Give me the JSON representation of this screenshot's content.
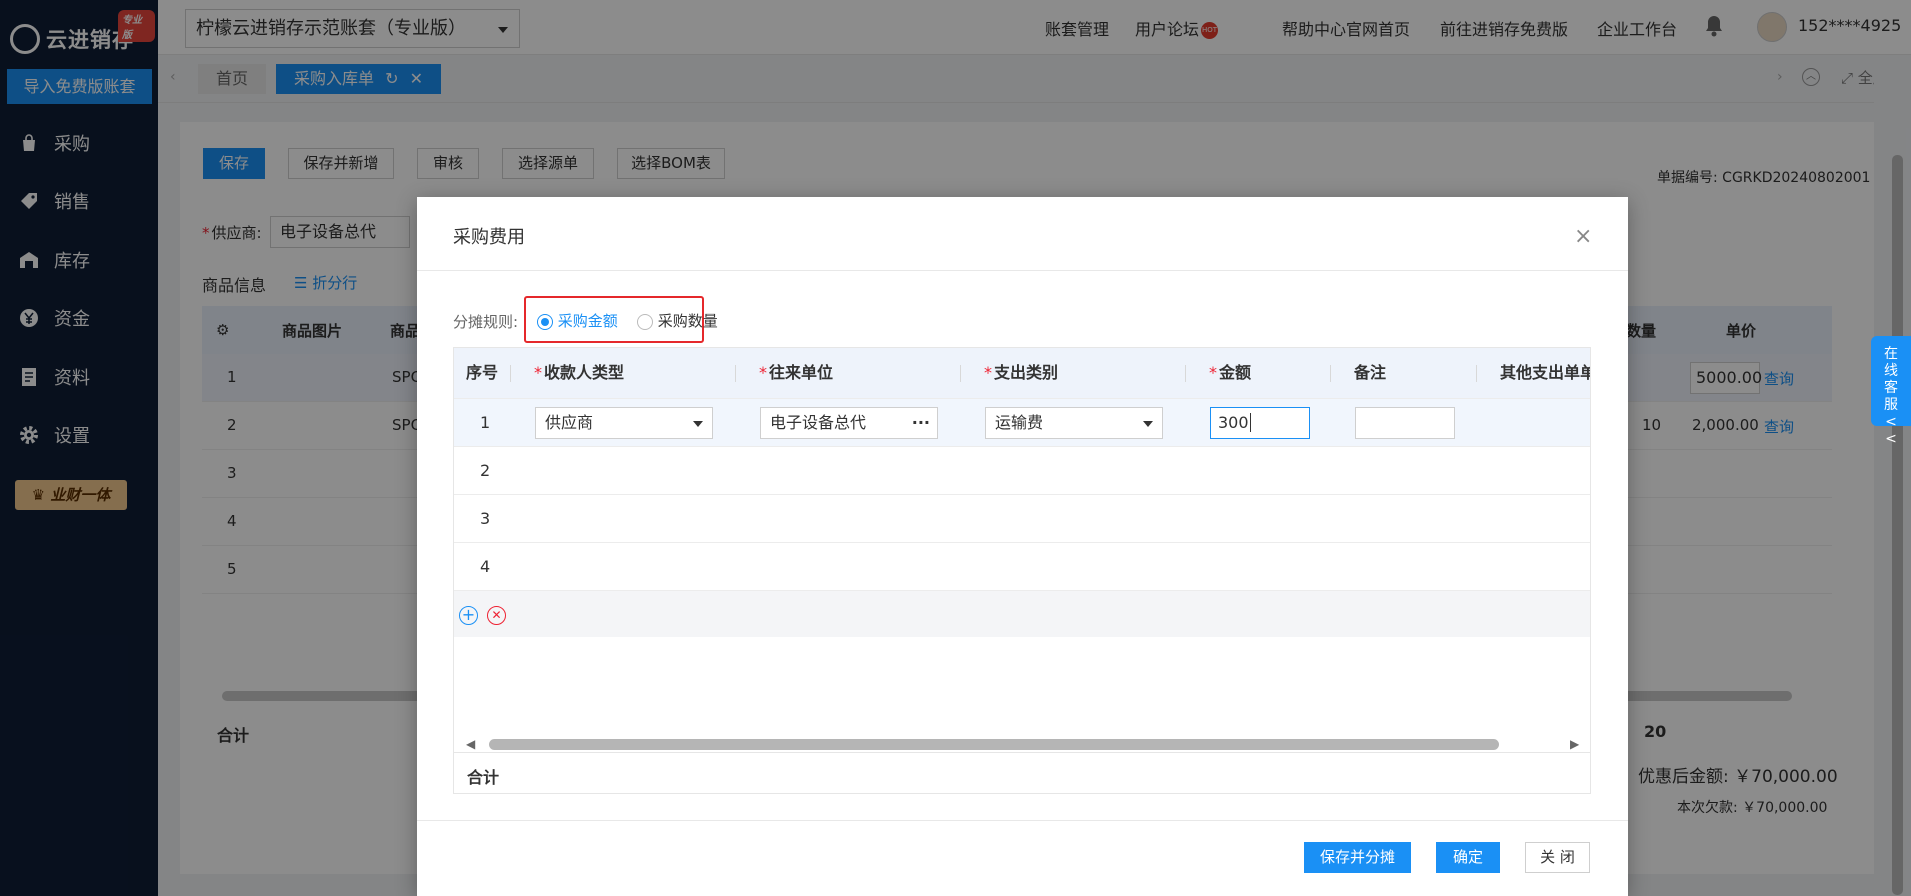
{
  "brand": {
    "name": "云进销存",
    "edition_badge": "专业版"
  },
  "sidebar": {
    "import_button": "导入免费版账套",
    "items": [
      {
        "label": "采购",
        "icon": "bag-icon"
      },
      {
        "label": "销售",
        "icon": "tag-icon"
      },
      {
        "label": "库存",
        "icon": "warehouse-icon"
      },
      {
        "label": "资金",
        "icon": "yen-icon"
      },
      {
        "label": "资料",
        "icon": "document-icon"
      },
      {
        "label": "设置",
        "icon": "gear-icon"
      }
    ],
    "vip_label": "业财一体"
  },
  "header": {
    "account_name": "柠檬云进销存示范账套（专业版）",
    "links": [
      "账套管理",
      "用户论坛",
      "帮助中心",
      "官网首页",
      "前往进销存免费版",
      "企业工作台"
    ],
    "hot_badge": "HOT",
    "user": "152****4925"
  },
  "tabs": {
    "items": [
      "首页",
      "采购入库单"
    ],
    "active": "采购入库单",
    "fullscreen_label": "全屏"
  },
  "page": {
    "toolbar": [
      "保存",
      "保存并新增",
      "审核",
      "选择源单",
      "选择BOM表"
    ],
    "doc_number_label": "单据编号:",
    "doc_number": "CGRKD20240802001",
    "supplier_label": "供应商:",
    "supplier_value": "电子设备总代",
    "goods_info_label": "商品信息",
    "split_row_label": "折分行",
    "table_headers": [
      "商品图片",
      "商品",
      "数量",
      "单价"
    ],
    "rows": [
      {
        "no": "1",
        "code": "SPC",
        "qty": "",
        "price": "5000.00",
        "link": "查询"
      },
      {
        "no": "2",
        "code": "SPC",
        "qty": "10",
        "price": "2,000.00",
        "link": "查询"
      },
      {
        "no": "3"
      },
      {
        "no": "4"
      },
      {
        "no": "5"
      }
    ],
    "total_label": "合计",
    "total_qty": "20",
    "discount_label": "优惠后金额:",
    "discount_value": "￥70,000.00",
    "debt_label": "本次欠款:",
    "debt_value": "￥70,000.00"
  },
  "online_service": "在线客服<<",
  "dialog": {
    "title": "采购费用",
    "allocation_label": "分摊规则:",
    "options": [
      {
        "label": "采购金额",
        "selected": true
      },
      {
        "label": "采购数量",
        "selected": false
      }
    ],
    "columns": [
      "序号",
      "收款人类型",
      "往来单位",
      "支出类别",
      "金额",
      "备注",
      "其他支出单单"
    ],
    "rows": [
      {
        "no": "1",
        "payee_type": "供应商",
        "partner": "电子设备总代",
        "category": "运输费",
        "amount": "300",
        "note": ""
      },
      {
        "no": "2"
      },
      {
        "no": "3"
      },
      {
        "no": "4"
      }
    ],
    "total_label": "合计",
    "buttons": {
      "save_allocate": "保存并分摊",
      "confirm": "确定",
      "close": "关 闭"
    }
  }
}
